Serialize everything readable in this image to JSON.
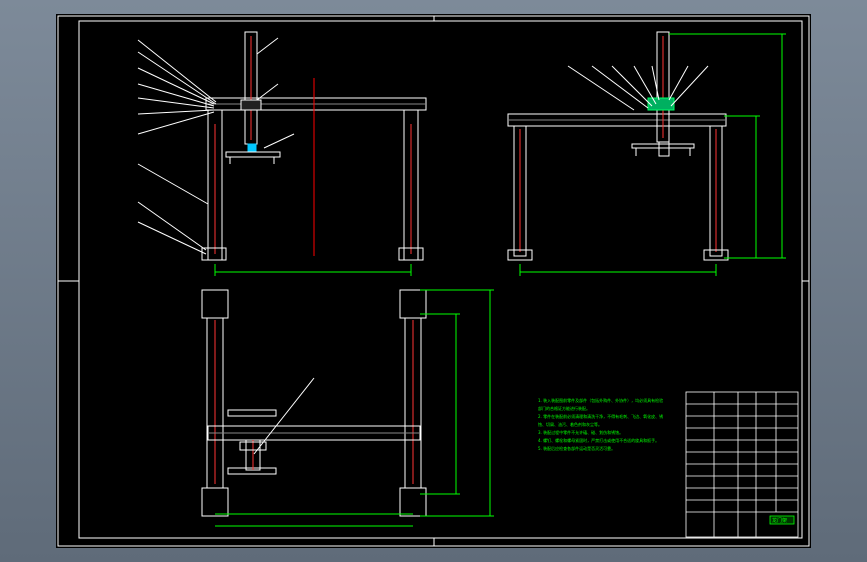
{
  "drawing": {
    "background": "#000000",
    "frame_color": "#ffffff",
    "frame_line_color": "#ffffff",
    "dimension_color": "#00ff00",
    "centerline_color": "#ff0000",
    "text_color": "#00ff00",
    "title_block_title": "龙门架",
    "notes": [
      "1. 装入装配图前零件及部件（包括外购件、外协件），均必须具有检验",
      "部门的合格证方能进行装配。",
      "2. 零件在装配前必须清理和清洗干净，不得有毛刺、飞边、氧化皮、锈",
      "蚀、切屑、油污、着色剂和灰尘等。",
      "3. 装配过程中零件不允许磕、碰、划伤和锈蚀。",
      "4. 螺钉、螺栓和螺母紧固时，严禁打击或使用不合适的旋具和扳手。",
      "5. 装配后应检查各部件运动是否灵活可靠。"
    ]
  }
}
